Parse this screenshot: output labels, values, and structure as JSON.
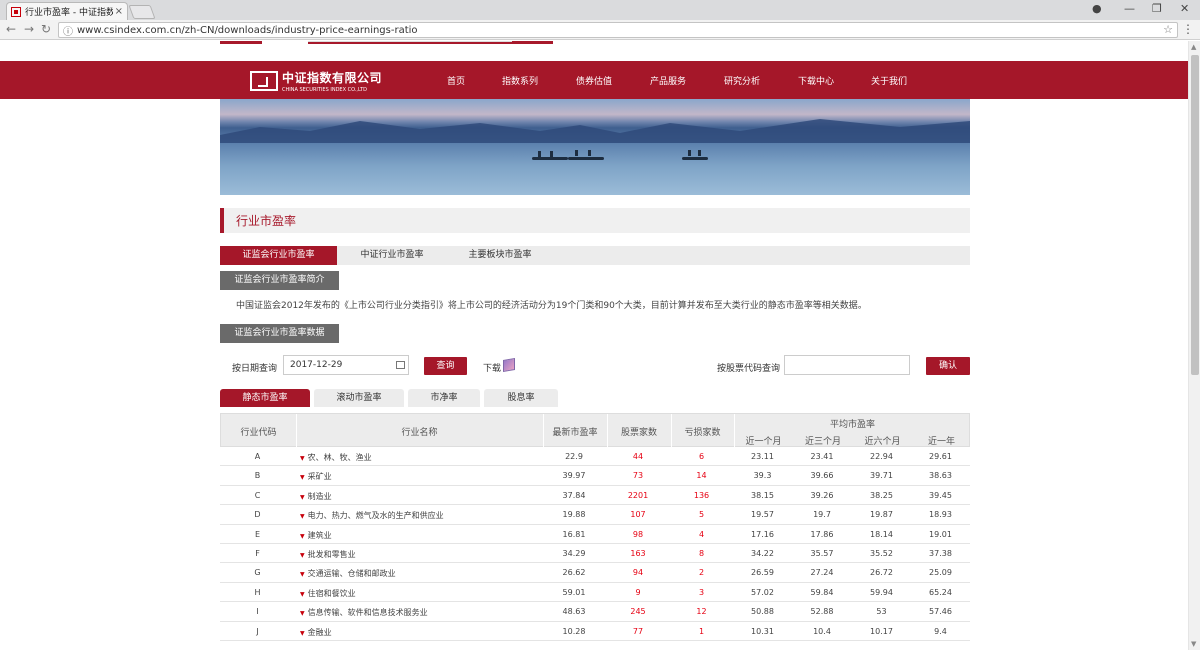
{
  "browser": {
    "tab_title": "行业市盈率 - 中证指数有...",
    "tab_close": "×",
    "url": "www.csindex.com.cn/zh-CN/downloads/industry-price-earnings-ratio",
    "controls": {
      "profile": "●",
      "minimize": "—",
      "restore": "❐",
      "close": "✕"
    }
  },
  "header": {
    "logo_cn": "中证指数有限公司",
    "logo_en": "CHINA SECURITIES INDEX CO.,LTD",
    "nav": [
      "首页",
      "指数系列",
      "债券估值",
      "产品服务",
      "研究分析",
      "下载中心",
      "关于我们"
    ]
  },
  "page": {
    "section_title": "行业市盈率",
    "tabs": [
      "证监会行业市盈率",
      "中证行业市盈率",
      "主要板块市盈率"
    ],
    "intro_button": "证监会行业市盈率简介",
    "intro_text": "中国证监会2012年发布的《上市公司行业分类指引》将上市公司的经济活动分为19个门类和90个大类，目前计算并发布至大类行业的静态市盈率等相关数据。",
    "data_button": "证监会行业市盈率数据",
    "date_label": "按日期查询",
    "date_value": "2017-12-29",
    "query_button": "查询",
    "download_label": "下载",
    "code_label": "按股票代码查询",
    "confirm_button": "确认",
    "subtabs": [
      "静态市盈率",
      "滚动市盈率",
      "市净率",
      "股息率"
    ]
  },
  "table": {
    "headers": {
      "code": "行业代码",
      "name": "行业名称",
      "latest_pe": "最新市盈率",
      "stock_count": "股票家数",
      "loss_count": "亏损家数",
      "avg_pe": "平均市盈率",
      "m1": "近一个月",
      "m3": "近三个月",
      "m6": "近六个月",
      "y1": "近一年"
    },
    "rows": [
      {
        "code": "A",
        "name": "农、林、牧、渔业",
        "pe": "22.9",
        "stocks": "44",
        "loss": "6",
        "m1": "23.11",
        "m3": "23.41",
        "m6": "22.94",
        "y1": "29.61"
      },
      {
        "code": "B",
        "name": "采矿业",
        "pe": "39.97",
        "stocks": "73",
        "loss": "14",
        "m1": "39.3",
        "m3": "39.66",
        "m6": "39.71",
        "y1": "38.63"
      },
      {
        "code": "C",
        "name": "制造业",
        "pe": "37.84",
        "stocks": "2201",
        "loss": "136",
        "m1": "38.15",
        "m3": "39.26",
        "m6": "38.25",
        "y1": "39.45"
      },
      {
        "code": "D",
        "name": "电力、热力、燃气及水的生产和供应业",
        "pe": "19.88",
        "stocks": "107",
        "loss": "5",
        "m1": "19.57",
        "m3": "19.7",
        "m6": "19.87",
        "y1": "18.93"
      },
      {
        "code": "E",
        "name": "建筑业",
        "pe": "16.81",
        "stocks": "98",
        "loss": "4",
        "m1": "17.16",
        "m3": "17.86",
        "m6": "18.14",
        "y1": "19.01"
      },
      {
        "code": "F",
        "name": "批发和零售业",
        "pe": "34.29",
        "stocks": "163",
        "loss": "8",
        "m1": "34.22",
        "m3": "35.57",
        "m6": "35.52",
        "y1": "37.38"
      },
      {
        "code": "G",
        "name": "交通运输、仓储和邮政业",
        "pe": "26.62",
        "stocks": "94",
        "loss": "2",
        "m1": "26.59",
        "m3": "27.24",
        "m6": "26.72",
        "y1": "25.09"
      },
      {
        "code": "H",
        "name": "住宿和餐饮业",
        "pe": "59.01",
        "stocks": "9",
        "loss": "3",
        "m1": "57.02",
        "m3": "59.84",
        "m6": "59.94",
        "y1": "65.24"
      },
      {
        "code": "I",
        "name": "信息传输、软件和信息技术服务业",
        "pe": "48.63",
        "stocks": "245",
        "loss": "12",
        "m1": "50.88",
        "m3": "52.88",
        "m6": "53",
        "y1": "57.46"
      },
      {
        "code": "J",
        "name": "金融业",
        "pe": "10.28",
        "stocks": "77",
        "loss": "1",
        "m1": "10.31",
        "m3": "10.4",
        "m6": "10.17",
        "y1": "9.4"
      }
    ]
  }
}
